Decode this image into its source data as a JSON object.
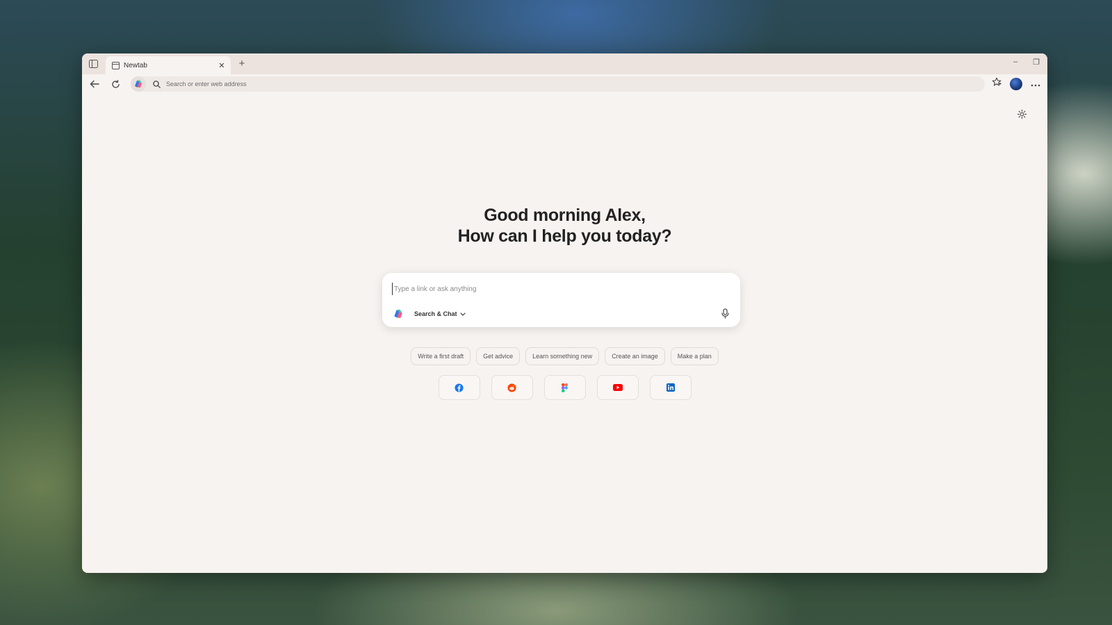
{
  "browser": {
    "tab_title": "Newtab",
    "new_tab_symbol": "+",
    "close_symbol": "✕",
    "minimize_symbol": "–",
    "restore_symbol": "❐"
  },
  "address_bar": {
    "placeholder": "Search or enter web address"
  },
  "greeting": {
    "line1": "Good morning Alex,",
    "line2": "How can I help you today?"
  },
  "chat": {
    "placeholder": "Type a link or ask anything",
    "mode_label": "Search & Chat"
  },
  "suggestions": [
    "Write a first draft",
    "Get advice",
    "Learn something new",
    "Create an image",
    "Make a plan"
  ],
  "shortcuts": [
    {
      "icon": "facebook-icon",
      "color": "#1877f2"
    },
    {
      "icon": "reddit-icon",
      "color": "#ff4500"
    },
    {
      "icon": "figma-icon",
      "color": "#a259ff"
    },
    {
      "icon": "youtube-icon",
      "color": "#ff0000"
    },
    {
      "icon": "linkedin-icon",
      "color": "#0a66c2"
    }
  ],
  "colors": {
    "window_bg": "#f7f3f0",
    "tabbar_bg": "#ece3df",
    "text_primary": "#222222"
  }
}
